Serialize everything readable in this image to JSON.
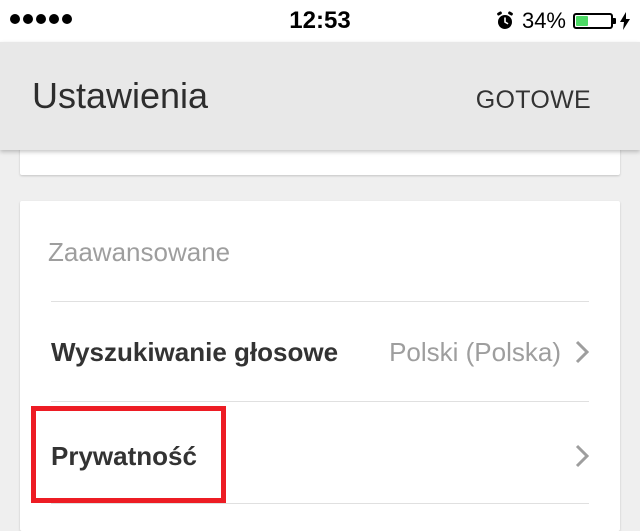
{
  "status_bar": {
    "time": "12:53",
    "battery_percent": "34%",
    "battery_level": 0.34,
    "signal_dots": 5,
    "icons": [
      "signal-dots-icon",
      "alarm-icon",
      "battery-icon",
      "charging-bolt-icon"
    ],
    "battery_color": "#4cd964"
  },
  "app_bar": {
    "title": "Ustawienia",
    "done_label": "GOTOWE"
  },
  "advanced": {
    "header": "Zaawansowane",
    "items": [
      {
        "label": "Wyszukiwanie głosowe",
        "value": "Polski (Polska)",
        "icon": "chevron-right-icon"
      },
      {
        "label": "Prywatność",
        "value": "",
        "icon": "chevron-right-icon"
      }
    ]
  },
  "annotation": {
    "color": "#ed1c24",
    "target": "Prywatność"
  }
}
